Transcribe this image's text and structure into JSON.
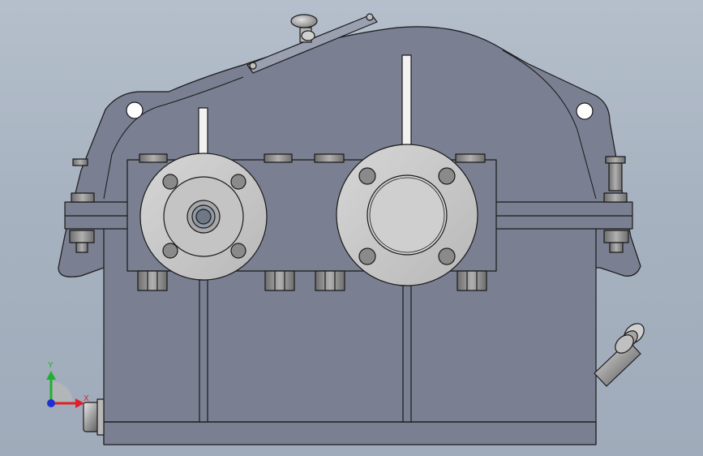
{
  "viewport": {
    "background_top": "#b5bfcc",
    "background_bottom": "#9fabba"
  },
  "model": {
    "body_color": "#7a7f91",
    "edge_color": "#1a1a1a",
    "flange_color": "#c8c8c8",
    "bolt_color": "#8a8a8a",
    "shaft_color": "#f2f2f2"
  },
  "triad": {
    "x_label": "X",
    "y_label": "Y",
    "x_color": "#e0202a",
    "y_color": "#20b030",
    "z_color": "#2030d0"
  }
}
